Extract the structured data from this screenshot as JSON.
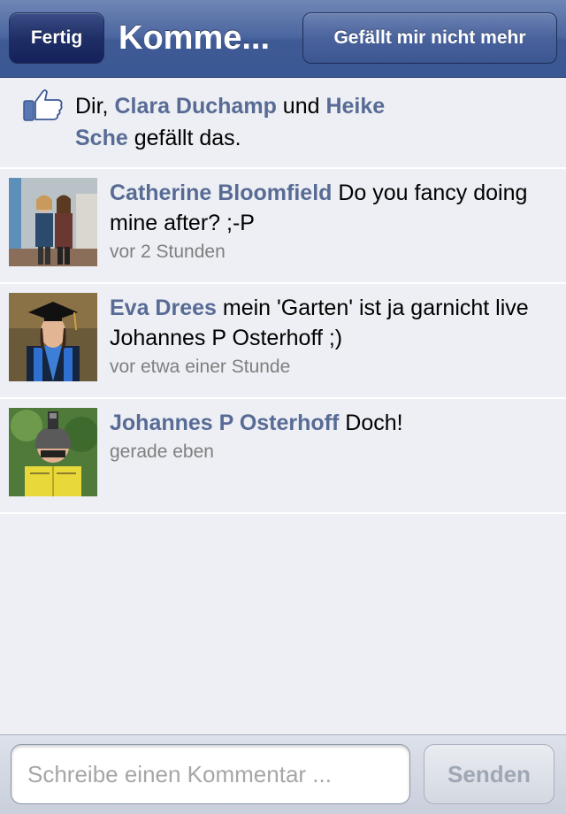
{
  "navbar": {
    "done_label": "Fertig",
    "title": "Komme...",
    "unlike_label": "Gefällt mir nicht mehr"
  },
  "likes": {
    "icon": "thumbs-up-icon",
    "prefix": "Dir, ",
    "person1": "Clara Duchamp",
    "connector": " und ",
    "person2": "Heike Sche",
    "suffix": " gefällt das."
  },
  "comments": [
    {
      "author": "Catherine Bloomfield",
      "text": "Do you fancy doing mine after? ;-P",
      "time": "vor 2 Stunden"
    },
    {
      "author": "Eva Drees",
      "text": "mein 'Garten' ist ja garnicht live Johannes P Osterhoff ;)",
      "time": "vor etwa einer Stunde"
    },
    {
      "author": "Johannes P Osterhoff",
      "text": "Doch!",
      "time": "gerade eben"
    }
  ],
  "composer": {
    "placeholder": "Schreibe einen Kommentar ...",
    "value": "",
    "send_label": "Senden"
  },
  "colors": {
    "navbar": "#3b5894",
    "link": "#576b95",
    "background": "#edeff4"
  }
}
